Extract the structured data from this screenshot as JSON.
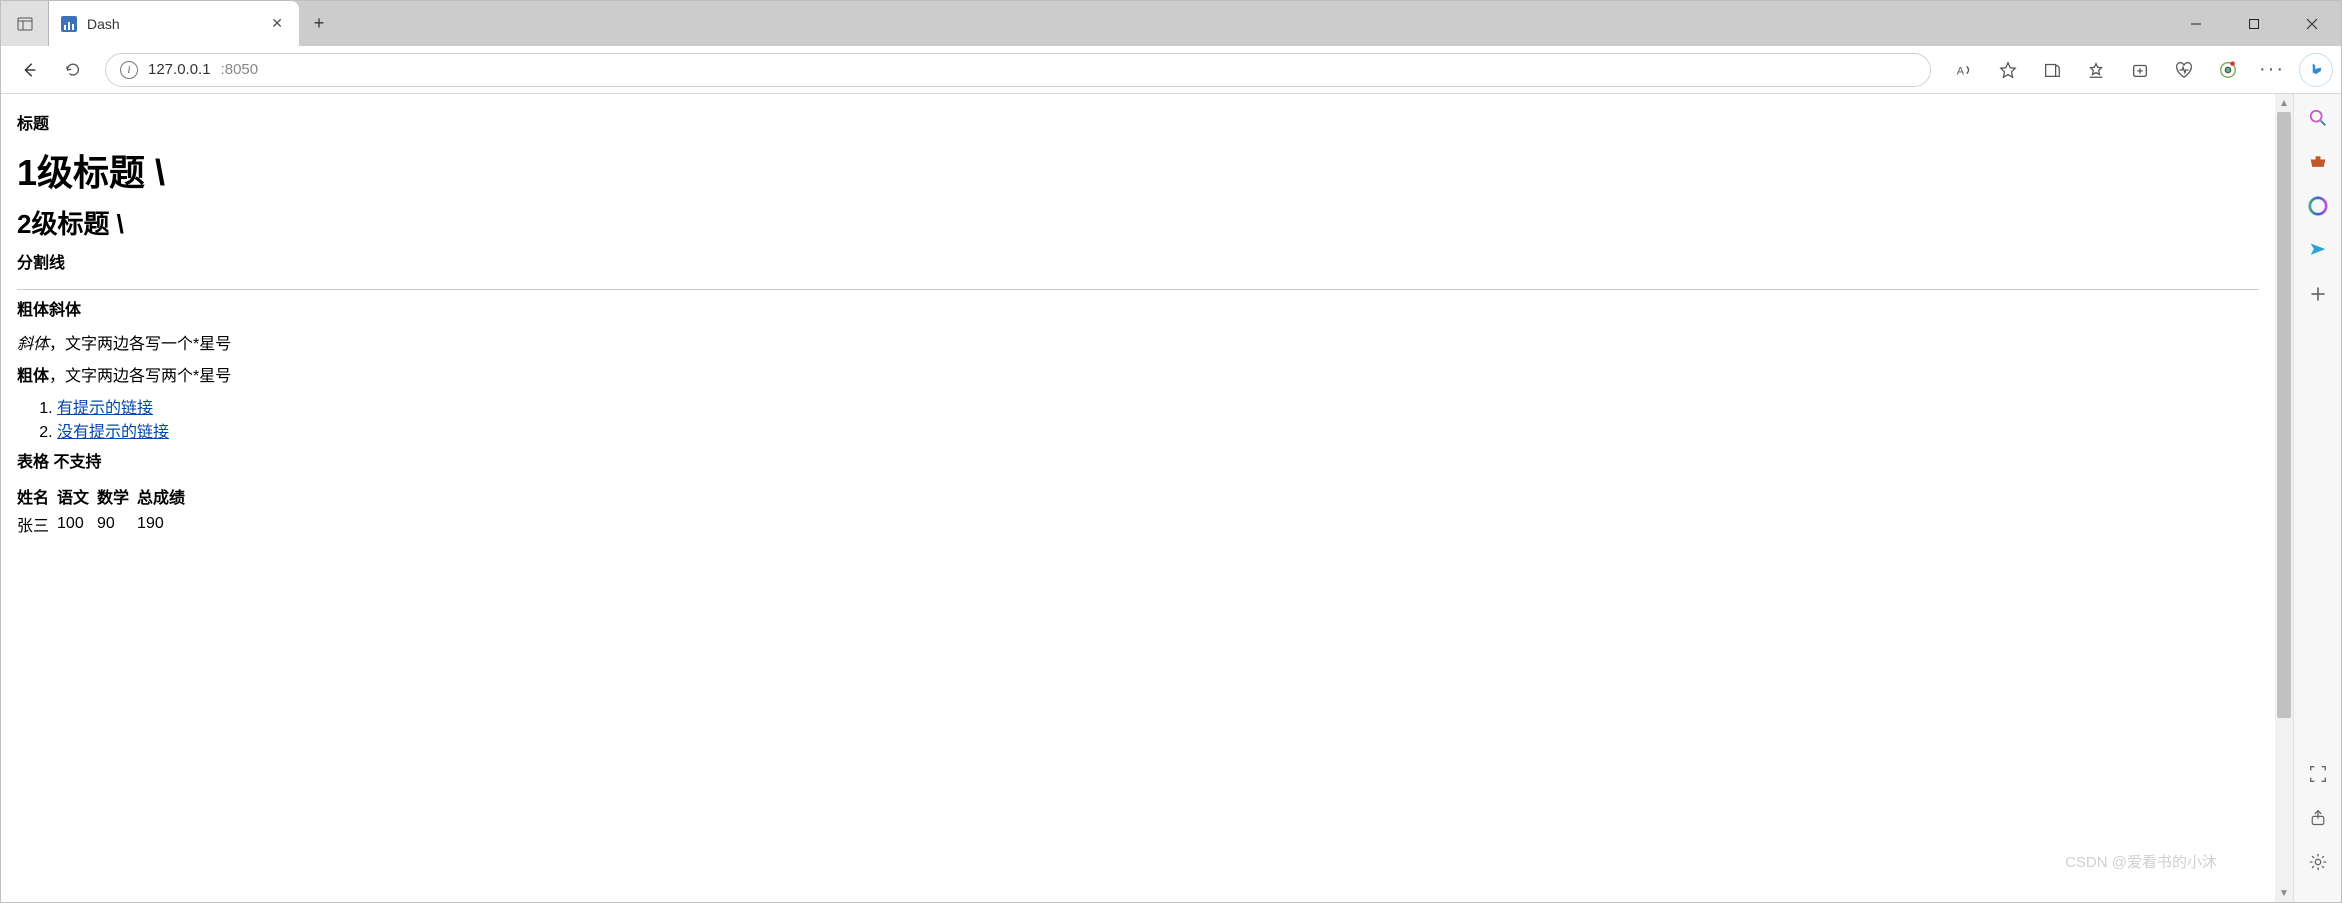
{
  "window": {
    "tab_title": "Dash",
    "close_glyph": "✕",
    "newtab_glyph": "+"
  },
  "addressbar": {
    "url_host": "127.0.0.1",
    "url_port": ":8050"
  },
  "page": {
    "label_title": "标题",
    "h1_text": "1级标题 \\",
    "h2_text": "2级标题 \\",
    "label_divider": "分割线",
    "label_boldItalic": "粗体斜体",
    "italic_word": "斜体",
    "italic_rest": "，文字两边各写一个*星号",
    "bold_word": "粗体",
    "bold_rest": "，文字两边各写两个*星号",
    "link1": "有提示的链接",
    "link2": "没有提示的链接",
    "label_table": "表格 不支持",
    "table": {
      "headers": [
        "姓名",
        "语文",
        "数学",
        "总成绩"
      ],
      "row1": [
        "张三",
        "100",
        "90",
        "190"
      ]
    }
  },
  "watermark": "CSDN @爱看书的小沐"
}
